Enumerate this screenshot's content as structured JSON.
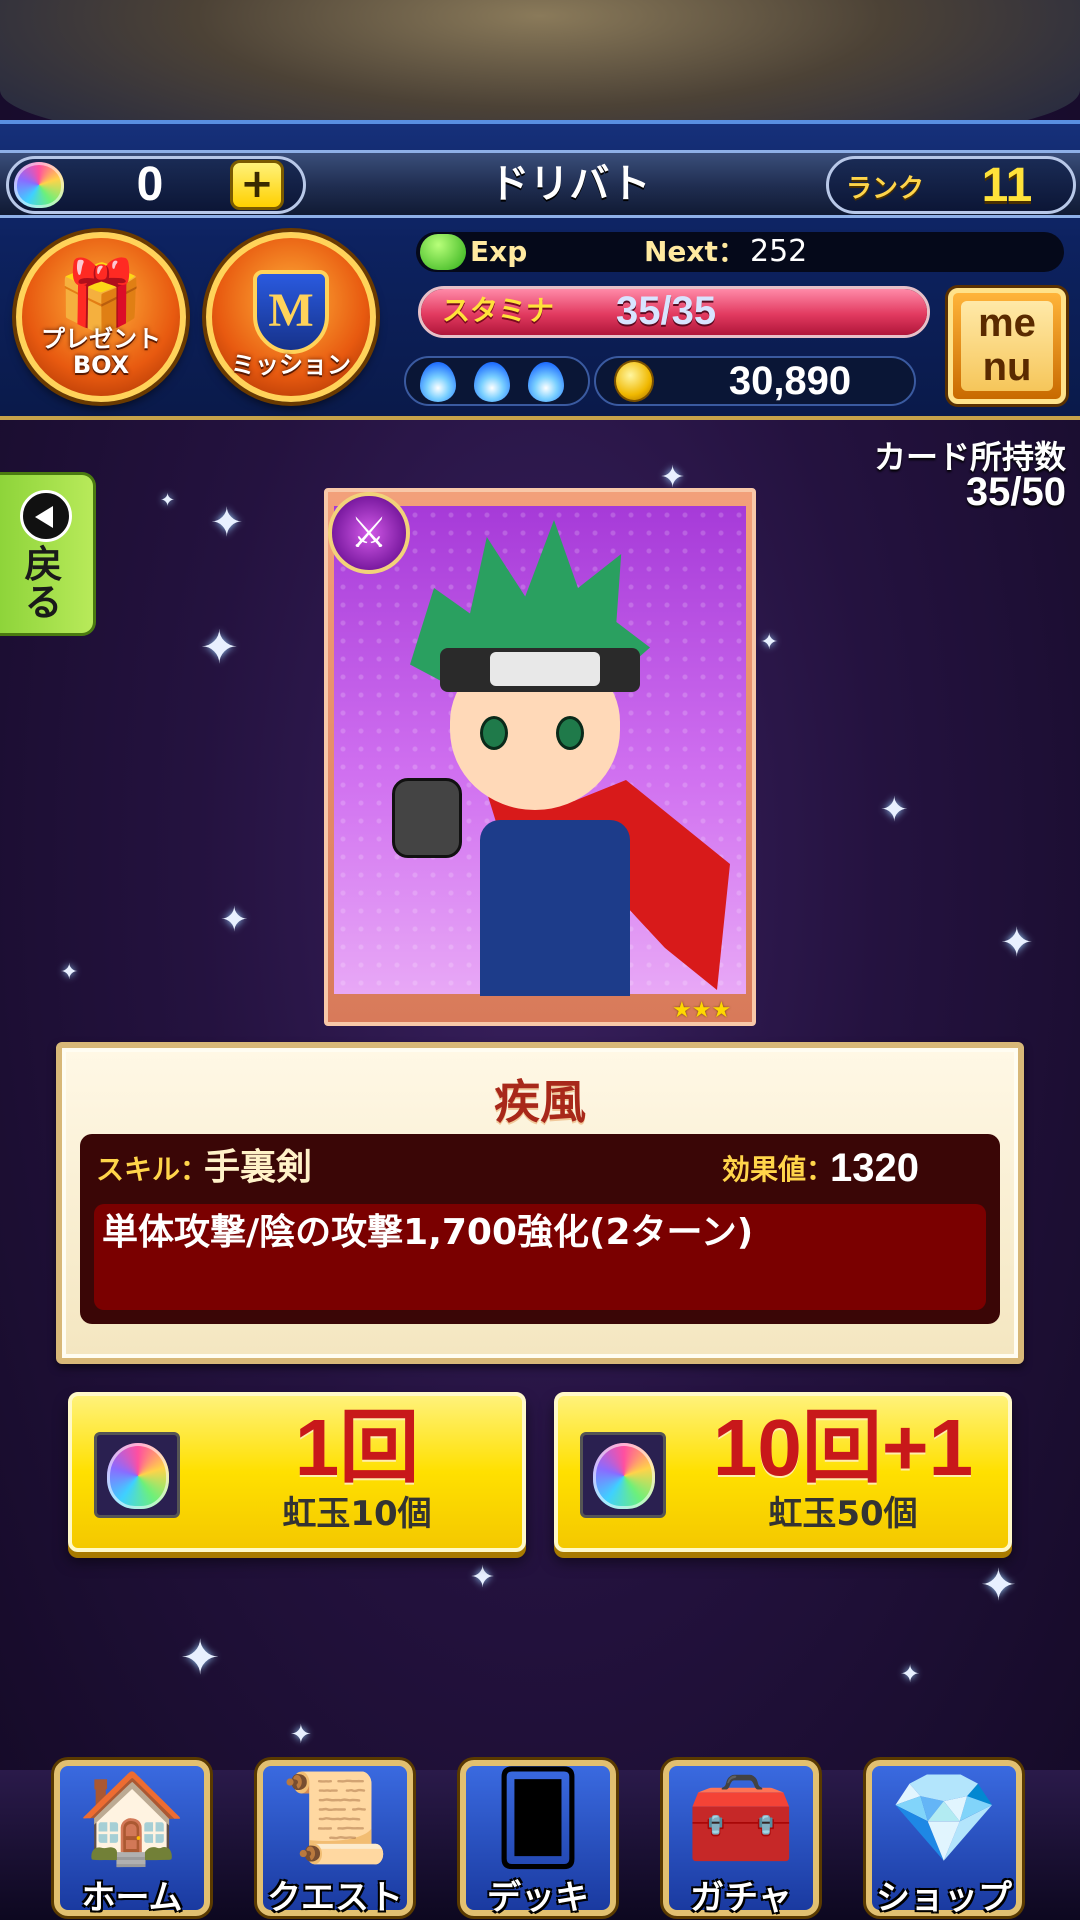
{
  "header": {
    "gem_count": "0",
    "plus_label": "+",
    "player_name": "ドリバト",
    "rank_label": "ランク",
    "rank_value": "11"
  },
  "buttons": {
    "present_label": "プレゼント\nBOX",
    "mission_label": "ミッション",
    "mission_crest": "M",
    "menu_label": "me\nnu"
  },
  "status": {
    "exp_label": "Exp",
    "next_label": "Next：",
    "next_value": "252",
    "stamina_label": "スタミナ",
    "stamina_value": "35/35",
    "stamina_fraction": 1.0,
    "flame_count": 3,
    "coins": "30,890"
  },
  "collection": {
    "label": "カード所持数",
    "value": "35/50"
  },
  "back": {
    "label": "戻る"
  },
  "card": {
    "name": "疾風",
    "stars": "★★★",
    "attribute_icon": "sword-icon",
    "skill_label": "スキル：",
    "skill_name": "手裏剣",
    "effect_label": "効果値：",
    "effect_value": "1320",
    "skill_description": "単体攻撃/陰の攻撃1,700強化(2ターン)"
  },
  "gacha": [
    {
      "title": "1回",
      "cost": "虹玉10個"
    },
    {
      "title": "10回+1",
      "cost": "虹玉50個"
    }
  ],
  "nav": [
    {
      "label": "ホーム",
      "icon": "house-icon"
    },
    {
      "label": "クエスト",
      "icon": "scroll-icon"
    },
    {
      "label": "デッキ",
      "icon": "cards-icon"
    },
    {
      "label": "ガチャ",
      "icon": "treasure-chest-icon"
    },
    {
      "label": "ショップ",
      "icon": "rainbow-gem-icon"
    }
  ],
  "colors": {
    "accent_yellow": "#ffe000",
    "stamina_pink": "#e23a60",
    "card_name_red": "#a8281a",
    "nav_frame": "#e2c070"
  }
}
